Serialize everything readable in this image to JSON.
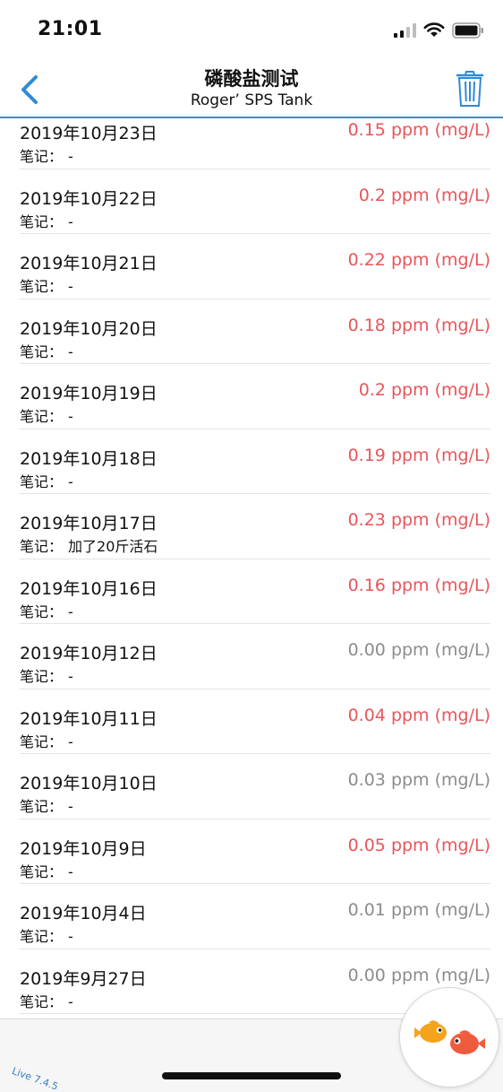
{
  "status": {
    "time": "21:01"
  },
  "nav": {
    "title": "磷酸盐测试",
    "subtitle": "Roger’ SPS Tank"
  },
  "note_label": "笔记：",
  "colors": {
    "accent": "#3a8fd0",
    "value_red": "#e8555a",
    "value_gray": "#8c8c8c"
  },
  "icons": {
    "back": "chevron-left-icon",
    "trash": "trash-icon",
    "fish": "fish-logo-icon"
  },
  "entries": [
    {
      "date": "2019年10月23日",
      "value": "0.15 ppm (mg/L)",
      "note": "-",
      "color": "red"
    },
    {
      "date": "2019年10月22日",
      "value": "0.2 ppm (mg/L)",
      "note": "-",
      "color": "red"
    },
    {
      "date": "2019年10月21日",
      "value": "0.22 ppm (mg/L)",
      "note": "-",
      "color": "red"
    },
    {
      "date": "2019年10月20日",
      "value": "0.18 ppm (mg/L)",
      "note": "-",
      "color": "red"
    },
    {
      "date": "2019年10月19日",
      "value": "0.2 ppm (mg/L)",
      "note": "-",
      "color": "red"
    },
    {
      "date": "2019年10月18日",
      "value": "0.19 ppm (mg/L)",
      "note": "-",
      "color": "red"
    },
    {
      "date": "2019年10月17日",
      "value": "0.23 ppm (mg/L)",
      "note": "加了20斤活石",
      "color": "red"
    },
    {
      "date": "2019年10月16日",
      "value": "0.16 ppm (mg/L)",
      "note": "-",
      "color": "red"
    },
    {
      "date": "2019年10月12日",
      "value": "0.00 ppm (mg/L)",
      "note": "-",
      "color": "gray"
    },
    {
      "date": "2019年10月11日",
      "value": "0.04 ppm (mg/L)",
      "note": "-",
      "color": "red"
    },
    {
      "date": "2019年10月10日",
      "value": "0.03 ppm (mg/L)",
      "note": "-",
      "color": "gray"
    },
    {
      "date": "2019年10月9日",
      "value": "0.05 ppm (mg/L)",
      "note": "-",
      "color": "red"
    },
    {
      "date": "2019年10月4日",
      "value": "0.01 ppm (mg/L)",
      "note": "-",
      "color": "gray"
    },
    {
      "date": "2019年9月27日",
      "value": "0.00 ppm (mg/L)",
      "note": "-",
      "color": "gray"
    }
  ],
  "footer": {
    "version": "Live 7.4.5"
  }
}
